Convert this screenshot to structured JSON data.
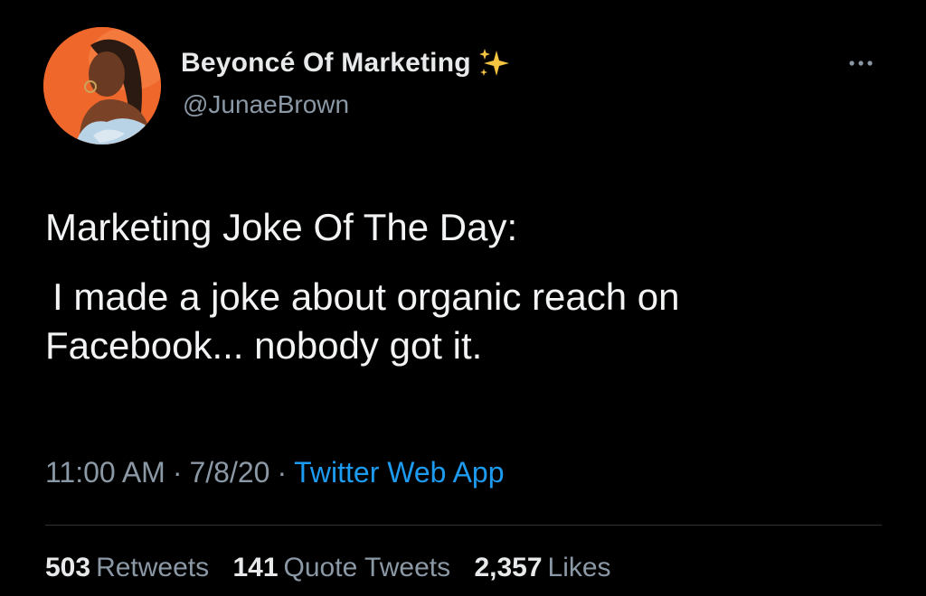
{
  "author": {
    "display_name": "Beyoncé Of Marketing",
    "handle": "@JunaeBrown",
    "avatar_icon": "profile-avatar",
    "badge_icon": "sparkles-icon"
  },
  "tweet": {
    "lines": [
      "Marketing Joke Of The Day:",
      "I made a joke about organic reach on",
      "Facebook... nobody got it."
    ]
  },
  "meta": {
    "time": "11:00 AM",
    "separator": "·",
    "date": "7/8/20",
    "source": "Twitter Web App"
  },
  "stats": {
    "retweets_count": "503",
    "retweets_label": "Retweets",
    "quotes_count": "141",
    "quotes_label": "Quote Tweets",
    "likes_count": "2,357",
    "likes_label": "Likes"
  },
  "colors": {
    "background": "#000000",
    "primary_text": "#e7e9ea",
    "secondary_text": "#8b98a5",
    "link": "#1d9bf0",
    "avatar_bg": "#f0672b",
    "sparkle": "#f5c542"
  }
}
